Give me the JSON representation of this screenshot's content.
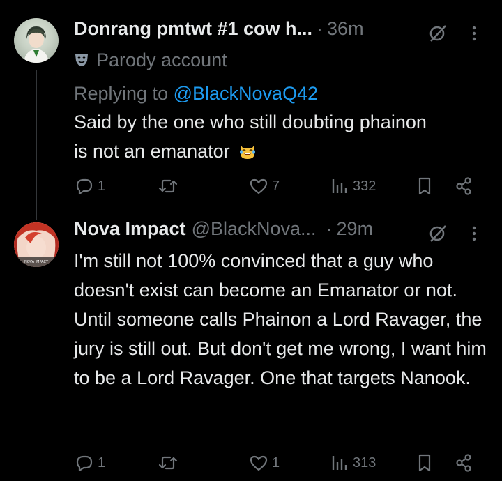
{
  "tweets": [
    {
      "name": "Donrang pmtwt #1 cow h...",
      "time": "36m",
      "dot": "·",
      "badge": "Parody account",
      "reply_prefix": "Replying to",
      "reply_handle": "@BlackNovaQ42",
      "text": "Said by the one who still doubting phainon is not an emanator",
      "emoji": "laughing-cat-emoji",
      "replies": "1",
      "retweets": "",
      "likes": "7",
      "views": "332"
    },
    {
      "name": "Nova Impact",
      "handle": "@BlackNova...",
      "time": "29m",
      "dot": "·",
      "text": "I'm still not 100% convinced that a guy who doesn't exist can become an Emanator or not. Until someone calls Phainon a Lord Ravager, the jury is still out. But don't get me wrong, I want him to be a Lord Ravager. One that targets Nanook.",
      "replies": "1",
      "retweets": "",
      "likes": "1",
      "views": "313"
    }
  ],
  "colors": {
    "background": "#000000",
    "text": "#e7e9ea",
    "muted": "#71767b",
    "link": "#1d9bf0",
    "thread_line": "#333639"
  },
  "icons": [
    "reply-icon",
    "retweet-icon",
    "like-icon",
    "views-icon",
    "bookmark-icon",
    "share-icon",
    "grok-icon",
    "more-icon",
    "parody-mask-icon"
  ]
}
